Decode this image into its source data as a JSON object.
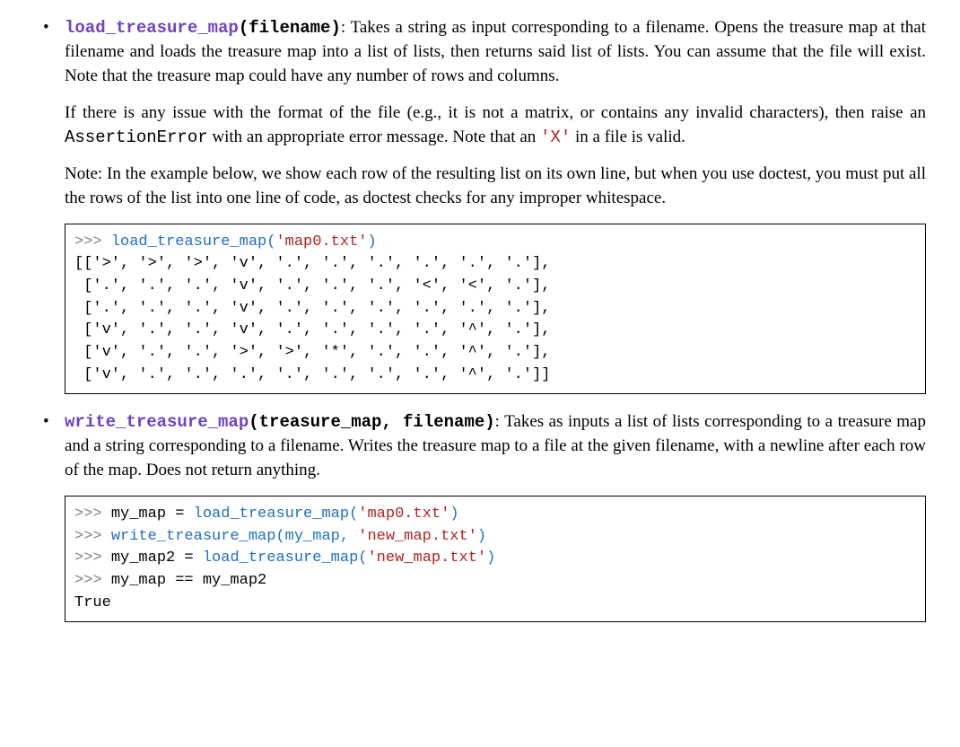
{
  "item1": {
    "funcName": "load_treasure_map",
    "sigTail": "(filename)",
    "para1_a": ": Takes a string as input corresponding to a filename. Opens the treasure map at that filename and loads the treasure map into a list of lists, then returns said list of lists. You can assume that the file will exist. Note that the treasure map could have any number of rows and columns.",
    "para2_a": "If there is any issue with the format of the file (e.g., it is not a matrix, or contains any invalid characters), then raise an ",
    "para2_code": "AssertionError",
    "para2_b": " with an appropriate error message. Note that an ",
    "para2_x": "'X'",
    "para2_c": " in a file is valid.",
    "para3": "Note: In the example below, we show each row of the resulting list on its own line, but when you use doctest, you must put all the rows of the list into one line of code, as doctest checks for any improper whitespace.",
    "code": {
      "prompt": ">>> ",
      "call_func": "load_treasure_map(",
      "call_arg": "'map0.txt'",
      "call_close": ")",
      "output": "[['>', '>', '>', 'v', '.', '.', '.', '.', '.', '.'],\n ['.', '.', '.', 'v', '.', '.', '.', '<', '<', '.'],\n ['.', '.', '.', 'v', '.', '.', '.', '.', '.', '.'],\n ['v', '.', '.', 'v', '.', '.', '.', '.', '^', '.'],\n ['v', '.', '.', '>', '>', '*', '.', '.', '^', '.'],\n ['v', '.', '.', '.', '.', '.', '.', '.', '^', '.']]"
    }
  },
  "item2": {
    "funcName": "write_treasure_map",
    "sigTail": "(treasure_map, filename)",
    "para1_a": ": Takes as inputs a list of lists corresponding to a treasure map and a string corresponding to a filename. Writes the treasure map to a file at the given filename, with a newline after each row of the map. Does not return anything.",
    "code": {
      "l1_prompt": ">>> ",
      "l1_pre": "my_map = ",
      "l1_func": "load_treasure_map(",
      "l1_arg": "'map0.txt'",
      "l1_close": ")",
      "l2_prompt": ">>> ",
      "l2_func": "write_treasure_map(my_map, ",
      "l2_arg": "'new_map.txt'",
      "l2_close": ")",
      "l3_prompt": ">>> ",
      "l3_pre": "my_map2 = ",
      "l3_func": "load_treasure_map(",
      "l3_arg": "'new_map.txt'",
      "l3_close": ")",
      "l4_prompt": ">>> ",
      "l4_text": "my_map == my_map2",
      "l5_text": "True"
    }
  }
}
